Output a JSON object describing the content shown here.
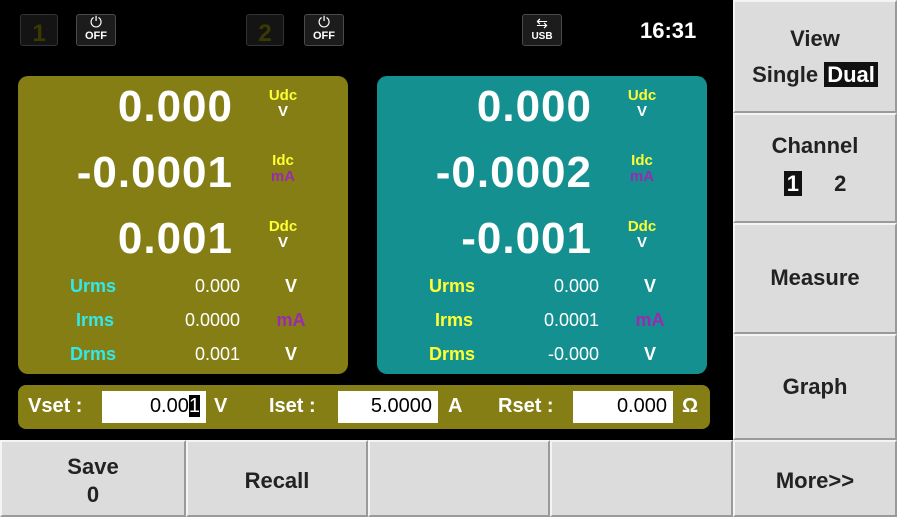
{
  "status": {
    "ch1_number": "1",
    "ch1_power": "OFF",
    "ch2_number": "2",
    "ch2_power": "OFF",
    "usb_label": "USB",
    "time": "16:31"
  },
  "channels": [
    {
      "udc_value": "0.000",
      "udc_label": "Udc",
      "udc_unit": "V",
      "idc_value": "-0.0001",
      "idc_label": "Idc",
      "idc_unit": "mA",
      "ddc_value": "0.001",
      "ddc_label": "Ddc",
      "ddc_unit": "V",
      "rows": [
        {
          "label": "Urms",
          "value": "0.000",
          "unit": "V"
        },
        {
          "label": "Irms",
          "value": "0.0000",
          "unit": "mA"
        },
        {
          "label": "Drms",
          "value": "0.001",
          "unit": "V"
        }
      ]
    },
    {
      "udc_value": "0.000",
      "udc_label": "Udc",
      "udc_unit": "V",
      "idc_value": "-0.0002",
      "idc_label": "Idc",
      "idc_unit": "mA",
      "ddc_value": "-0.001",
      "ddc_label": "Ddc",
      "ddc_unit": "V",
      "rows": [
        {
          "label": "Urms",
          "value": "0.000",
          "unit": "V"
        },
        {
          "label": "Irms",
          "value": "0.0001",
          "unit": "mA"
        },
        {
          "label": "Drms",
          "value": "-0.000",
          "unit": "V"
        }
      ]
    }
  ],
  "setbar": {
    "vset_label": "Vset :",
    "vset_value_pre": "0.00",
    "vset_value_cursor": "1",
    "vset_unit": "V",
    "iset_label": "Iset :",
    "iset_value": "5.0000",
    "iset_unit": "A",
    "rset_label": "Rset :",
    "rset_value": "0.000",
    "rset_unit": "Ω"
  },
  "softkeys": {
    "view_title": "View",
    "view_single": "Single",
    "view_dual": "Dual",
    "channel_title": "Channel",
    "channel_1": "1",
    "channel_2": "2",
    "measure": "Measure",
    "graph": "Graph",
    "more": "More>>"
  },
  "bottomkeys": {
    "save_title": "Save",
    "save_value": "0",
    "recall": "Recall"
  }
}
